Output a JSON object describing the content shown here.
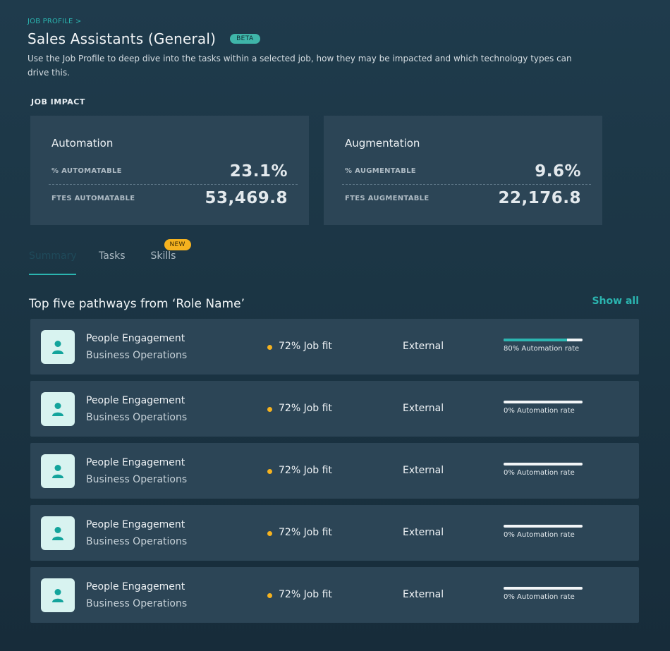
{
  "header": {
    "breadcrumb": "JOB PROFILE >",
    "title": "Sales Assistants (General)",
    "badge": "BETA",
    "description": "Use the Job Profile to deep dive into the tasks within a selected job, how they may be impacted and which technology types can drive this."
  },
  "job_impact": {
    "label": "JOB IMPACT",
    "automation": {
      "title": "Automation",
      "pct_label": "% AUTOMATABLE",
      "pct_value": "23.1%",
      "fte_label": "FTES AUTOMATABLE",
      "fte_value": "53,469.8"
    },
    "augmentation": {
      "title": "Augmentation",
      "pct_label": "% AUGMENTABLE",
      "pct_value": "9.6%",
      "fte_label": "FTES AUGMENTABLE",
      "fte_value": "22,176.8"
    }
  },
  "tabs": [
    {
      "label": "Summary",
      "active": true
    },
    {
      "label": "Tasks",
      "active": false
    },
    {
      "label": "Skills",
      "active": false,
      "badge": "NEW"
    }
  ],
  "pathways": {
    "title": "Top five pathways from ‘Role Name’",
    "show_all": "Show all",
    "rows": [
      {
        "title": "People Engagement",
        "subtitle": "Business Operations",
        "fit": "72% Job fit",
        "type": "External",
        "rate": 0.8,
        "rate_label": "80% Automation rate"
      },
      {
        "title": "People Engagement",
        "subtitle": "Business Operations",
        "fit": "72% Job fit",
        "type": "External",
        "rate": 0,
        "rate_label": "0% Automation rate"
      },
      {
        "title": "People Engagement",
        "subtitle": "Business Operations",
        "fit": "72% Job fit",
        "type": "External",
        "rate": 0,
        "rate_label": "0% Automation rate"
      },
      {
        "title": "People Engagement",
        "subtitle": "Business Operations",
        "fit": "72% Job fit",
        "type": "External",
        "rate": 0,
        "rate_label": "0% Automation rate"
      },
      {
        "title": "People Engagement",
        "subtitle": "Business Operations",
        "fit": "72% Job fit",
        "type": "External",
        "rate": 0,
        "rate_label": "0% Automation rate"
      }
    ]
  },
  "colors": {
    "accent": "#2bb5b0",
    "badge_new": "#f5b21f",
    "card_bg": "#2c4556"
  }
}
